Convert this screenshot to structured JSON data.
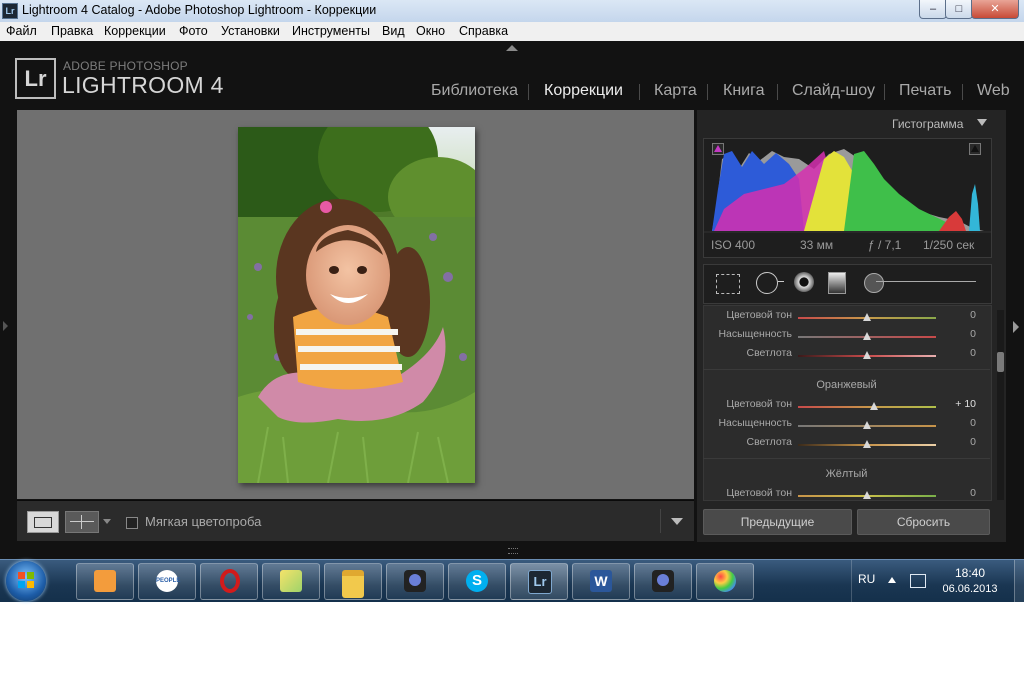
{
  "window": {
    "title": "Lightroom 4 Catalog - Adobe Photoshop Lightroom - Коррекции",
    "icon_text": "Lr",
    "buttons": {
      "minimize": "–",
      "maximize": "□",
      "close": "✕"
    }
  },
  "menu": [
    "Файл",
    "Правка",
    "Коррекции",
    "Фото",
    "Установки",
    "Инструменты",
    "Вид",
    "Окно",
    "Справка"
  ],
  "logo": {
    "badge": "Lr",
    "sub": "ADOBE PHOTOSHOP",
    "main": "LIGHTROOM 4"
  },
  "modules": [
    "Библиотека",
    "Коррекции",
    "Карта",
    "Книга",
    "Слайд-шоу",
    "Печать",
    "Web"
  ],
  "active_module": "Коррекции",
  "toolbar": {
    "soft_proof_label": "Мягкая цветопроба"
  },
  "histogram": {
    "title": "Гистограмма",
    "iso": "ISO 400",
    "focal": "33 мм",
    "aperture": "ƒ / 7,1",
    "shutter": "1/250 сек"
  },
  "hsl": {
    "top_rows": [
      {
        "label": "Цветовой тон",
        "value": "0",
        "pos": 0.5
      },
      {
        "label": "Насыщенность",
        "value": "0",
        "pos": 0.5
      },
      {
        "label": "Светлота",
        "value": "0",
        "pos": 0.5
      }
    ],
    "orange": {
      "title": "Оранжевый",
      "rows": [
        {
          "label": "Цветовой тон",
          "value": "+ 10",
          "pos": 0.55
        },
        {
          "label": "Насыщенность",
          "value": "0",
          "pos": 0.5
        },
        {
          "label": "Светлота",
          "value": "0",
          "pos": 0.5
        }
      ]
    },
    "yellow": {
      "title": "Жёлтый",
      "rows": [
        {
          "label": "Цветовой тон",
          "value": "0",
          "pos": 0.5
        }
      ]
    }
  },
  "panel_buttons": {
    "previous": "Предыдущие",
    "reset": "Сбросить"
  },
  "taskbar": {
    "lang": "RU",
    "time": "18:40",
    "date": "06.06.2013",
    "people_label": "PEOPLE"
  },
  "colors": {
    "app_bg": "#121212",
    "panel_bg": "#242424",
    "center_bg": "#707070",
    "taskbar": "#1a3652"
  }
}
